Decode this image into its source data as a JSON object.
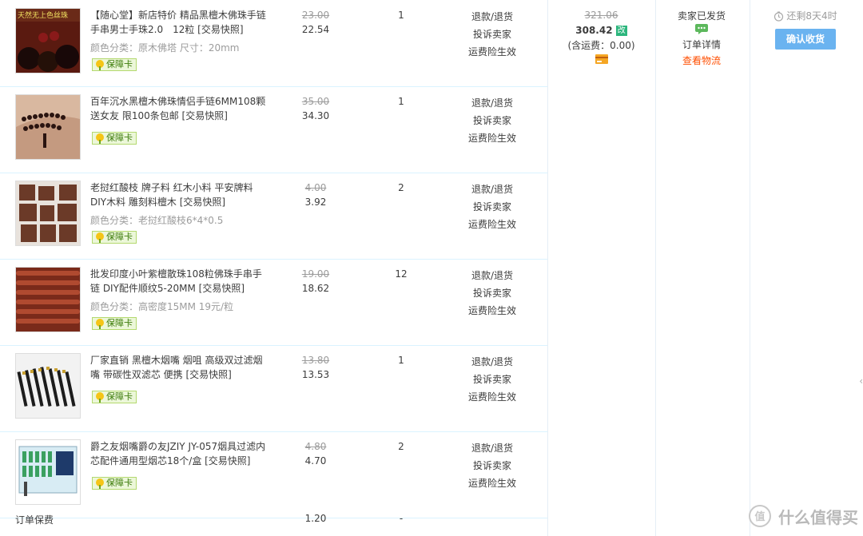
{
  "items": [
    {
      "title": "【随心堂】新店特价 精品黑檀木佛珠手链手串男士手珠2.0　12粒 [交易快照]",
      "spec": "颜色分类：原木佛塔 尺寸：20mm",
      "badge": "保障卡",
      "thumb_text": "天然无上色丝珠",
      "orig_price": "23.00",
      "price": "22.54",
      "qty": "1",
      "actions": [
        "退款/退货",
        "投诉卖家",
        "运费险生效"
      ]
    },
    {
      "title": "百年沉水黑檀木佛珠情侣手链6MM108颗送女友 限100条包邮 [交易快照]",
      "spec": "",
      "badge": "保障卡",
      "orig_price": "35.00",
      "price": "34.30",
      "qty": "1",
      "actions": [
        "退款/退货",
        "投诉卖家",
        "运费险生效"
      ]
    },
    {
      "title": "老挝红酸枝 牌子料 红木小料 平安牌料DIY木料 雕刻料檀木 [交易快照]",
      "spec": "颜色分类：老挝红酸枝6*4*0.5",
      "badge": "保障卡",
      "orig_price": "4.00",
      "price": "3.92",
      "qty": "2",
      "actions": [
        "退款/退货",
        "投诉卖家",
        "运费险生效"
      ]
    },
    {
      "title": "批发印度小叶紫檀散珠108粒佛珠手串手链 DIY配件顺纹5-20MM [交易快照]",
      "spec": "颜色分类：高密度15MM 19元/粒",
      "badge": "保障卡",
      "orig_price": "19.00",
      "price": "18.62",
      "qty": "12",
      "actions": [
        "退款/退货",
        "投诉卖家",
        "运费险生效"
      ]
    },
    {
      "title": "厂家直销 黑檀木烟嘴 烟咀 高级双过滤烟嘴 带碳性双滤芯 便携 [交易快照]",
      "spec": "",
      "badge": "保障卡",
      "orig_price": "13.80",
      "price": "13.53",
      "qty": "1",
      "actions": [
        "退款/退货",
        "投诉卖家",
        "运费险生效"
      ]
    },
    {
      "title": "爵之友烟嘴爵の友JZIY JY-057烟具过滤内芯配件通用型烟芯18个/盒 [交易快照]",
      "spec": "",
      "badge": "保障卡",
      "orig_price": "4.80",
      "price": "4.70",
      "qty": "2",
      "actions": [
        "退款/退货",
        "投诉卖家",
        "运费险生效"
      ]
    }
  ],
  "footer": {
    "label": "订单保费",
    "price": "1.20",
    "qty": "-"
  },
  "order": {
    "orig_total": "321.06",
    "total": "308.42",
    "modified_tag": "改",
    "shipping_note": "(含运费：0.00)",
    "status": "卖家已发货",
    "detail_link": "订单详情",
    "logistics_link": "查看物流",
    "remaining_time": "还剩8天4时",
    "confirm_button": "确认收货"
  },
  "watermark": {
    "text": "什么值得买",
    "icon": "值"
  },
  "colors": {
    "link_red": "#ff4e00",
    "confirm_blue": "#6ab3f0",
    "divider": "#daf3ff",
    "badge_green": "#ecf7d9"
  }
}
